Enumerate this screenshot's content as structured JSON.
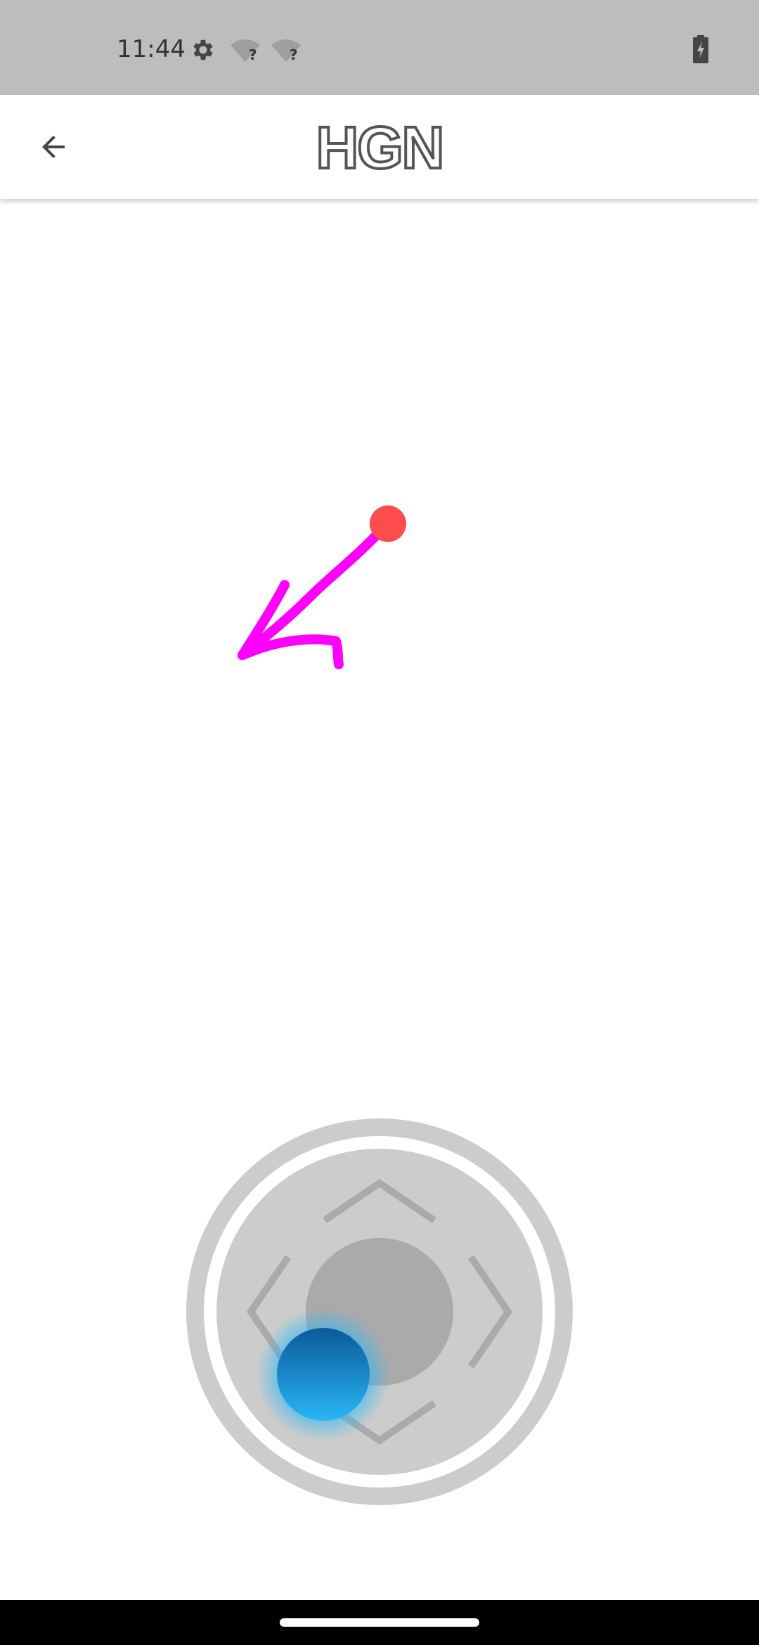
{
  "status_bar": {
    "time": "11:44",
    "icons": [
      "settings-gear-icon",
      "wifi-unknown-icon",
      "wifi-unknown-icon",
      "battery-charging-icon"
    ],
    "wifi_badge": "?"
  },
  "app_bar": {
    "title": "HGN",
    "back_icon": "arrow-back-icon"
  },
  "colors": {
    "status_bar_bg": "#bdbdbd",
    "annotation_stroke": "#ff00ff",
    "touch_point": "#ff4c4c",
    "joystick_ring": "#cccccc",
    "joystick_center": "#aaaaaa",
    "thumb_top": "#0b5a9a",
    "thumb_bottom": "#29b6f6"
  },
  "joystick": {
    "directions": [
      "up",
      "down",
      "left",
      "right"
    ]
  }
}
